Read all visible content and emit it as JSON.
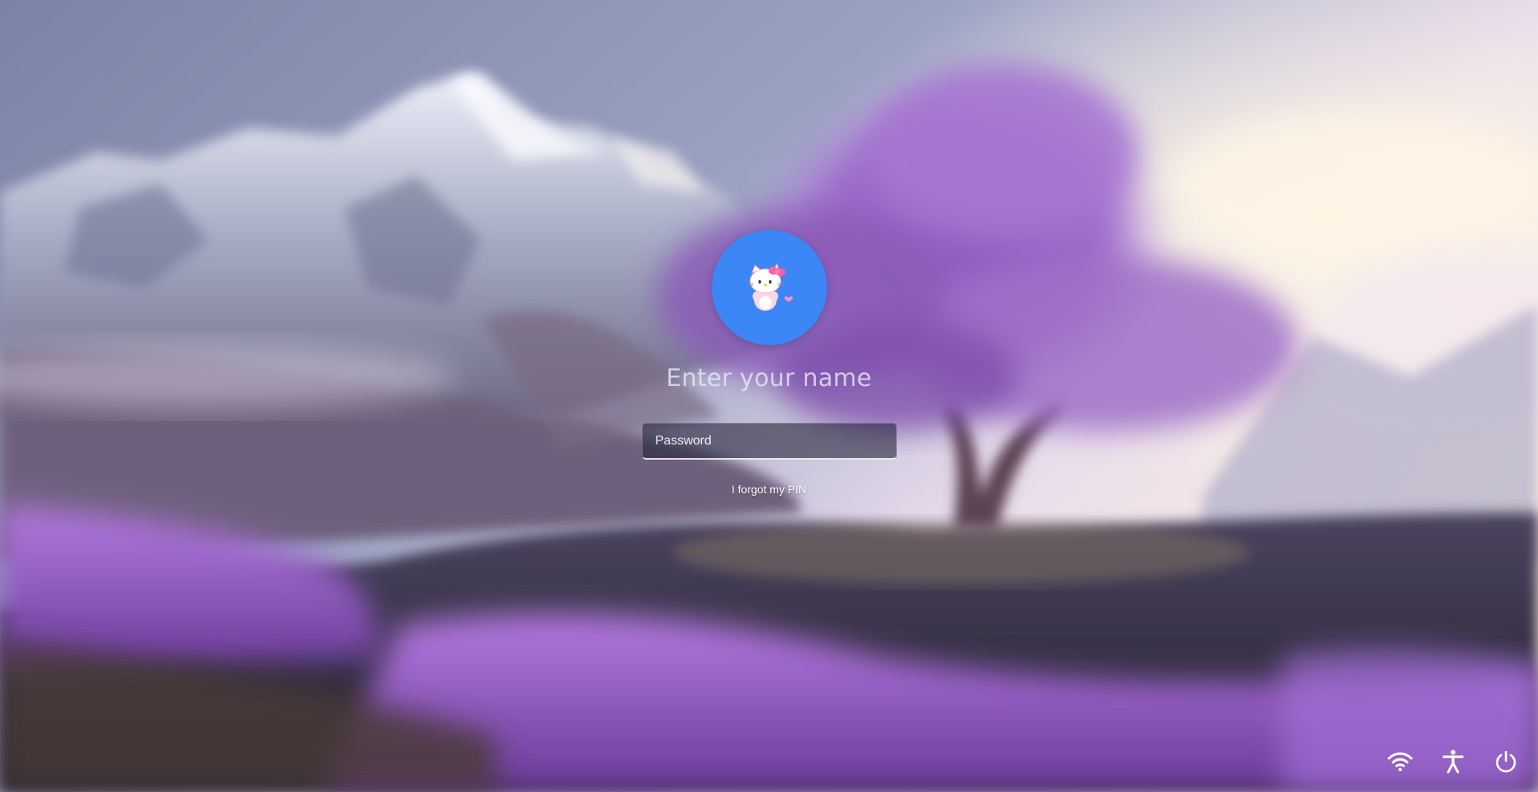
{
  "lock_screen": {
    "user": {
      "name": "Enter your name",
      "avatar_icon": "hello-kitty-avatar",
      "avatar_bg": "#3d86f5"
    },
    "password": {
      "placeholder": "Password",
      "value": ""
    },
    "forgot_pin_label": "I forgot my PIN",
    "wallpaper": "mountains-purple-tree-lavender-field"
  },
  "system_tray": {
    "items": [
      {
        "icon": "wifi-icon"
      },
      {
        "icon": "accessibility-icon"
      },
      {
        "icon": "power-icon"
      }
    ]
  }
}
